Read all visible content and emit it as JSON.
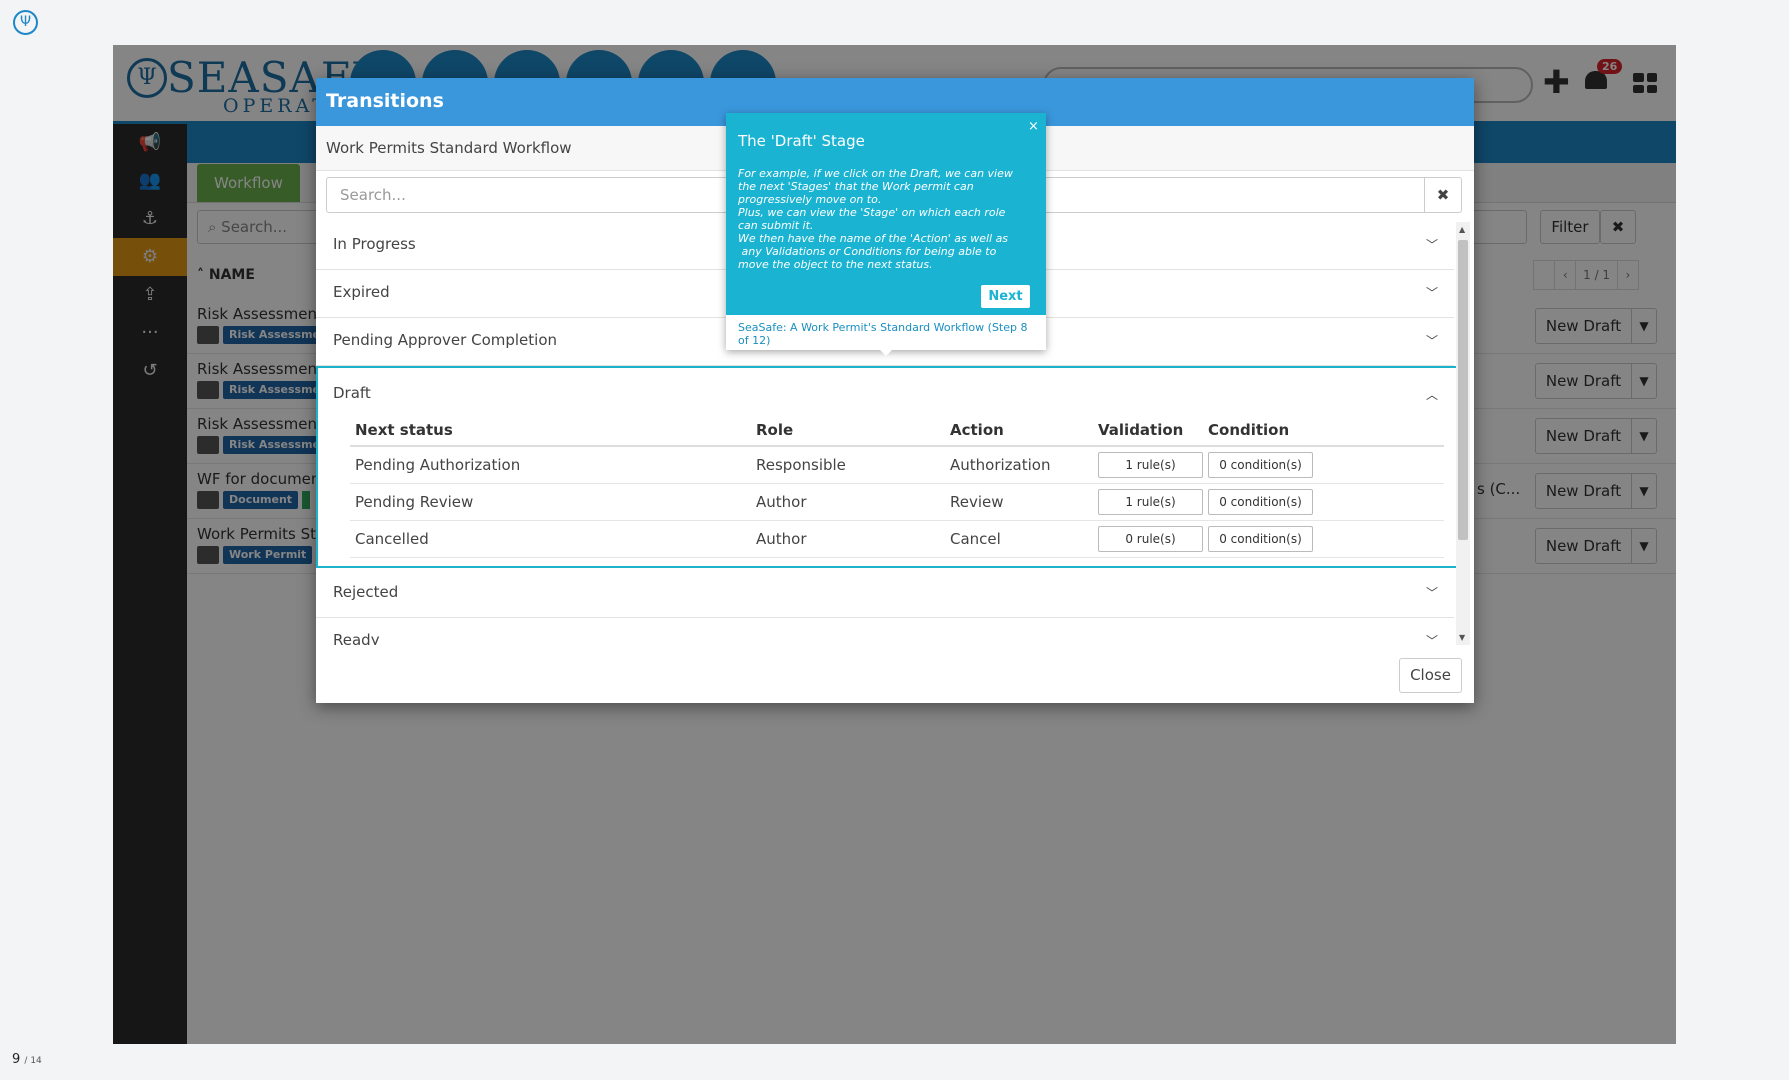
{
  "viewer": {
    "page_current": "9",
    "page_total": "/ 14",
    "logo_icon": "trident-icon"
  },
  "app": {
    "brand": {
      "word": "SEASAFE",
      "sub": "OPERATI"
    },
    "notifications_count": "26",
    "plus_label": "✚",
    "sidebar_icons": [
      "megaphone-icon",
      "users-icon",
      "captain-icon",
      "workflow-icon",
      "upload-icon",
      "more-icon",
      "history-icon"
    ],
    "workflow_tab": "Workflow",
    "search_placeholder": "Search...",
    "name_header": "NAME",
    "filter_label": "Filter",
    "pagination": {
      "prev": "‹",
      "current": "1 / 1",
      "next": "›"
    },
    "rows": [
      {
        "name": "Risk Assessment",
        "tag": "Risk Assessme",
        "action": "New Draft"
      },
      {
        "name": "Risk Assessment",
        "tag": "Risk Assessme",
        "action": "New Draft"
      },
      {
        "name": "Risk Assessment",
        "tag": "Risk Assessme",
        "action": "New Draft"
      },
      {
        "name": "WF for documen",
        "tag": "Document",
        "extra": "s (C...",
        "action": "New Draft"
      },
      {
        "name": "Work Permits Sta",
        "tag": "Work Permit",
        "action": "New Draft"
      }
    ]
  },
  "modal": {
    "title": "Transitions",
    "subtitle": "Work Permits Standard Workflow",
    "search_placeholder": "Search...",
    "clear_icon": "✖",
    "sections_before": [
      "In Progress",
      "Expired",
      "Pending Approver Completion"
    ],
    "open_section": {
      "title": "Draft",
      "columns": [
        "Next status",
        "Role",
        "Action",
        "Validation",
        "Condition"
      ],
      "rows": [
        {
          "next_status": "Pending Authorization",
          "role": "Responsible",
          "action": "Authorization",
          "validation": "1 rule(s)",
          "condition": "0 condition(s)"
        },
        {
          "next_status": "Pending Review",
          "role": "Author",
          "action": "Review",
          "validation": "1 rule(s)",
          "condition": "0 condition(s)"
        },
        {
          "next_status": "Cancelled",
          "role": "Author",
          "action": "Cancel",
          "validation": "0 rule(s)",
          "condition": "0 condition(s)"
        }
      ]
    },
    "sections_after": [
      "Rejected",
      "Ready"
    ],
    "close_label": "Close"
  },
  "tooltip": {
    "title": "The 'Draft' Stage",
    "close": "×",
    "body": "For example, if we click on the Draft, we can view the next 'Stages' that the Work permit can progressively move on to. Plus, we can view the 'Stage' on which each role can submit it. We then have the name of the 'Action' as well as any Validations or Conditions for being able to move the object to the next status.",
    "body_lines": [
      "For example, if we click on the Draft, we can view",
      "the next 'Stages' that the Work permit can",
      "progressively move on to.",
      "Plus, we can view the 'Stage' on which each role",
      "can submit it.",
      "We then have the name of the 'Action' as well as",
      " any Validations or Conditions for being able to",
      "move the object to the next status."
    ],
    "next_label": "Next",
    "footer": "SeaSafe: A Work Permit's Standard Workflow (Step 8 of 12)"
  },
  "colors": {
    "brand_blue": "#1e88c7",
    "modal_header": "#3a97dc",
    "tooltip": "#1ab3d1",
    "active_sidebar": "#e39a14",
    "workflow_tab": "#6ab04c",
    "badge": "#d9232d"
  }
}
